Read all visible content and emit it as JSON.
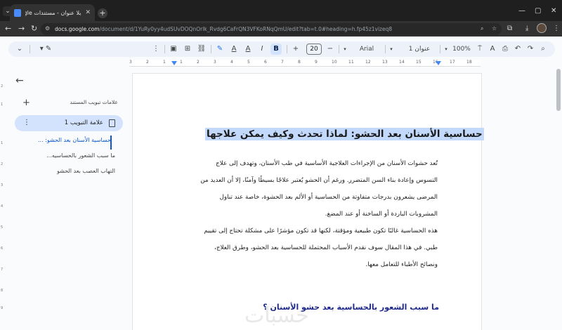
{
  "browser": {
    "tab_title": "بلا عنوان - مستندات Google",
    "url_domain": "docs.google.com",
    "url_path": "/document/d/1YuRy0yy4udSUvDOQnOrIk_Rvdg6CaFrQN3VFKoRNqQmU/edit?tab=t.0#heading=h.fp45z1vizeq8",
    "window_controls": [
      "—",
      "▢",
      "✕"
    ]
  },
  "toolbar": {
    "font_size": "20",
    "font_name": "Arial",
    "style_name": "عنوان 1",
    "zoom": "100%",
    "bold_label": "B",
    "italic_label": "I",
    "underline_label": "A"
  },
  "ruler": {
    "numbers": [
      "3",
      "2",
      "1",
      "1",
      "2",
      "3",
      "4",
      "5",
      "6",
      "7",
      "8",
      "9",
      "10",
      "11",
      "12",
      "13",
      "14",
      "15",
      "16",
      "17",
      "18"
    ]
  },
  "outline": {
    "header": "علامات تبويب المستند",
    "tab_label": "علامة التبويب 1",
    "items": [
      "حساسية الأسنان بعد الحشو: ...",
      "ما سبب الشعور بالحساسيه...",
      "التهاب العصب بعد الحشو"
    ]
  },
  "document": {
    "heading": "حساسية الأسنان بعد الحشو: لماذا تحدث وكيف يمكن علاجها",
    "paragraph_lines": [
      "تُعد حشوات الأسنان من الإجراءات العلاجية الأساسية في طب الأسنان، وتهدف إلى علاج",
      "التسوس وإعادة بناء السن المتضرر. ورغم أن الحشو يُعتبر علاجًا بسيطًا وآمنًا، إلا أن العديد من",
      "المرضى يشعرون بدرجات متفاوتة من الحساسية أو الألم بعد الحشوة، خاصة عند تناول",
      "المشروبات الباردة أو الساخنة أو عند المضغ.",
      "هذه الحساسية غالبًا تكون طبيعية ومؤقتة، لكنها قد تكون مؤشرًا على مشكلة تحتاج إلى تقييم",
      "طبي. في هذا المقال سوف نقدم الأسباب المحتملة للحساسية بعد الحشو، وطرق العلاج،",
      "ونصائح الأطباء للتعامل معها."
    ],
    "subheading": "ما سبب الشعور بالحساسية بعد حشو الأسنان ؟",
    "watermark": "حُسبات"
  },
  "colors": {
    "accent": "#0b57d0",
    "highlight": "#c3d9fb",
    "subheading": "#1f2a8a"
  }
}
